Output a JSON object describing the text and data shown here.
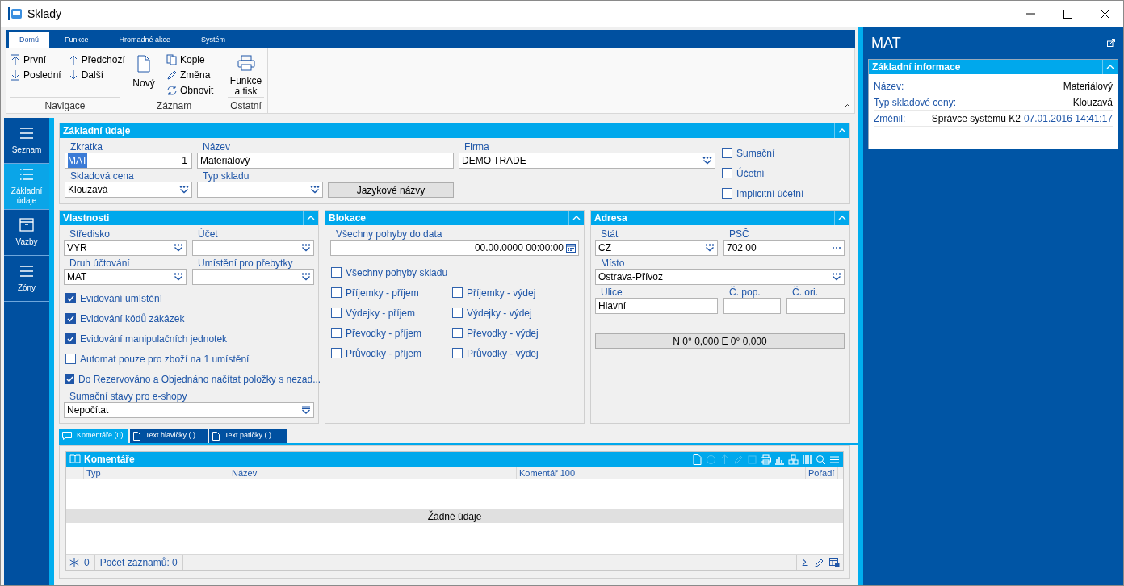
{
  "window": {
    "title": "Sklady"
  },
  "ribbon": {
    "tabs": [
      {
        "label": "Domů",
        "selected": true
      },
      {
        "label": "Funkce",
        "selected": false
      },
      {
        "label": "Hromadné akce",
        "selected": false
      },
      {
        "label": "Systém",
        "selected": false
      }
    ],
    "groups": [
      {
        "label": "Navigace",
        "items": [
          "První",
          "Předchozí",
          "Poslední",
          "Další"
        ]
      },
      {
        "label": "Záznam",
        "items": [
          "Nový",
          "Kopie",
          "Změna",
          "Obnovit"
        ]
      },
      {
        "label": "Ostatní",
        "items": [
          "Funkce a tisk"
        ]
      }
    ]
  },
  "nav": [
    {
      "label": "Seznam",
      "selected": false
    },
    {
      "label": "Základní údaje",
      "selected": true
    },
    {
      "label": "Vazby",
      "selected": false
    },
    {
      "label": "Zóny",
      "selected": false
    }
  ],
  "basic": {
    "title": "Základní údaje",
    "fields": [
      {
        "label": "Zkratka",
        "kind": "text",
        "value": "MAT",
        "value_selected": true,
        "counter": "1"
      },
      {
        "label": "Název",
        "kind": "text",
        "value": "Materiálový"
      },
      {
        "label": "Firma",
        "kind": "dropdown",
        "value": "DEMO TRADE"
      },
      {
        "label": "Skladová cena",
        "kind": "dropdown",
        "value": "Klouzavá"
      },
      {
        "label": "Typ skladu",
        "kind": "dropdown"
      }
    ],
    "button": "Jazykové názvy",
    "checkboxes": [
      {
        "label": "Sumační",
        "checked": false
      },
      {
        "label": "Účetní",
        "checked": false
      },
      {
        "label": "Implicitní účetní",
        "checked": false
      }
    ]
  },
  "properties": {
    "title": "Vlastnosti",
    "fields": [
      {
        "label": "Středisko",
        "kind": "dropdown",
        "value": "VYR"
      },
      {
        "label": "Účet",
        "kind": "dropdown"
      },
      {
        "label": "Druh účtování",
        "kind": "dropdown",
        "value": "MAT"
      },
      {
        "label": "Umístění pro přebytky",
        "kind": "dropdown"
      },
      {
        "label": "Sumační stavy pro e-shopy",
        "kind": "select",
        "value": "Nepočítat"
      }
    ],
    "checkboxes": [
      {
        "label": "Evidování umístění",
        "checked": true
      },
      {
        "label": "Evidování kódů zákázek",
        "checked": true
      },
      {
        "label": "Evidování manipulačních jednotek",
        "checked": true
      },
      {
        "label": "Automat pouze pro zboží na 1 umístění",
        "checked": false
      },
      {
        "label": "Do Rezervováno a Objednáno načítat položky s nezad...",
        "checked": true
      }
    ]
  },
  "blocking": {
    "title": "Blokace",
    "fields": [
      {
        "label": "Všechny pohyby do data",
        "kind": "date",
        "value": "00.00.0000 00:00:00"
      }
    ],
    "checkboxes": [
      {
        "label": "Všechny pohyby skladu",
        "checked": false
      },
      {
        "label": "Příjemky - příjem",
        "checked": false
      },
      {
        "label": "Příjemky - výdej",
        "checked": false
      },
      {
        "label": "Výdejky - příjem",
        "checked": false
      },
      {
        "label": "Výdejky - výdej",
        "checked": false
      },
      {
        "label": "Převodky - příjem",
        "checked": false
      },
      {
        "label": "Převodky - výdej",
        "checked": false
      },
      {
        "label": "Průvodky - příjem",
        "checked": false
      },
      {
        "label": "Průvodky - výdej",
        "checked": false
      }
    ]
  },
  "address": {
    "title": "Adresa",
    "fields": [
      {
        "label": "Stát",
        "kind": "dropdown",
        "value": "CZ"
      },
      {
        "label": "PSČ",
        "kind": "lookup",
        "value": "702 00"
      },
      {
        "label": "Místo",
        "kind": "dropdown",
        "value": "Ostrava-Přívoz"
      },
      {
        "label": "Ulice",
        "kind": "text",
        "value": "Hlavní"
      },
      {
        "label": "Č. pop.",
        "kind": "text"
      },
      {
        "label": "Č. ori.",
        "kind": "text"
      }
    ],
    "button": "N 0° 0,000 E 0° 0,000"
  },
  "bottom_tabs": [
    {
      "label": "Komentáře (0)",
      "selected": true
    },
    {
      "label": "Text hlavičky ( )",
      "selected": false
    },
    {
      "label": "Text patičky ( )",
      "selected": false
    }
  ],
  "grid": {
    "title": "Komentáře",
    "columns": [
      "Typ",
      "Název",
      "Komentář 100",
      "Pořadí"
    ],
    "empty_message": "Žádné údaje",
    "footer": {
      "count": "0",
      "records": "Počet záznamů: 0",
      "sum_symbol": "Σ"
    }
  },
  "info_panel": {
    "title": "MAT",
    "section": "Základní informace",
    "rows": [
      {
        "label": "Název:",
        "value": "Materiálový"
      },
      {
        "label": "Typ skladové ceny:",
        "value": "Klouzavá"
      },
      {
        "label": "Změnil:",
        "value": "Správce systému K2",
        "timestamp": "07.01.2016 14:41:17"
      }
    ]
  }
}
